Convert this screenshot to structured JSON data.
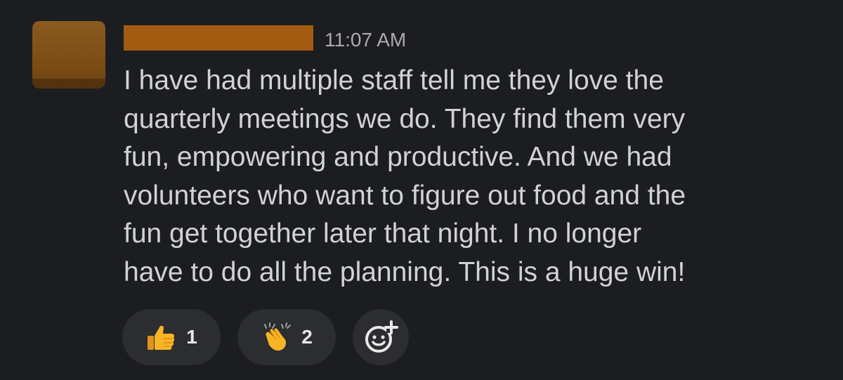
{
  "message": {
    "timestamp": "11:07 AM",
    "lines": [
      "I have had multiple staff tell me they love the",
      "quarterly meetings we do. They find them very",
      "fun, empowering and productive. And we had",
      "volunteers who want to figure out food and the",
      "fun get together later that night. I no longer",
      "have to do all the planning. This is a huge win!"
    ]
  },
  "reactions": [
    {
      "emoji": "thumbs-up-icon",
      "count": "1"
    },
    {
      "emoji": "clapping-hands-icon",
      "count": "2"
    }
  ],
  "colors": {
    "background": "#1c1d20",
    "text": "#d1d2d3",
    "timestamp": "#ababad",
    "redaction": "#a35b12",
    "reaction_pill": "#2c2d30",
    "emoji_yellow": "#f7b526"
  }
}
